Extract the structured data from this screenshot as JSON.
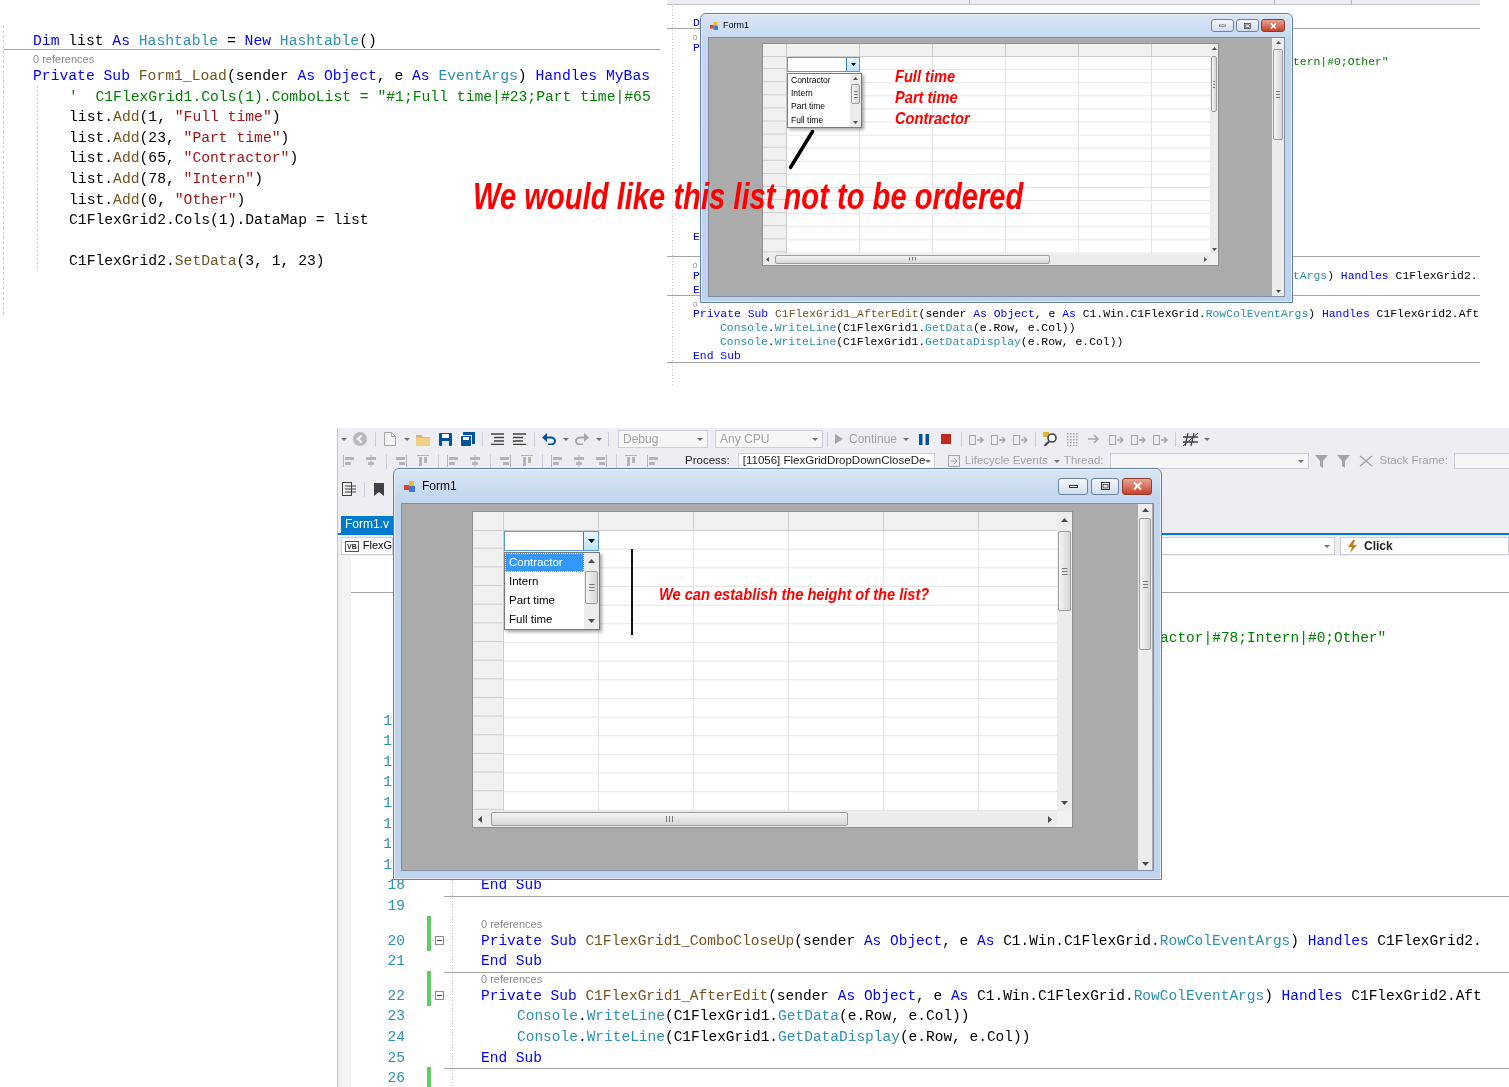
{
  "snippet": {
    "lines": [
      {
        "kind": "code",
        "separator_below": true,
        "tokens": [
          {
            "kind": "keyword",
            "text": "Dim "
          },
          {
            "kind": "plain",
            "text": "list "
          },
          {
            "kind": "keyword",
            "text": "As "
          },
          {
            "kind": "type",
            "text": "Hashtable"
          },
          {
            "kind": "plain",
            "text": " = "
          },
          {
            "kind": "keyword",
            "text": "New "
          },
          {
            "kind": "type",
            "text": "Hashtable"
          },
          {
            "kind": "plain",
            "text": "()"
          }
        ]
      },
      {
        "kind": "lens",
        "text": "0 references"
      },
      {
        "kind": "code",
        "separator_below": false,
        "tokens": [
          {
            "kind": "keyword",
            "text": "Private Sub "
          },
          {
            "kind": "method",
            "text": "Form1_Load"
          },
          {
            "kind": "plain",
            "text": "(sender "
          },
          {
            "kind": "keyword",
            "text": "As Object"
          },
          {
            "kind": "plain",
            "text": ", e "
          },
          {
            "kind": "keyword",
            "text": "As "
          },
          {
            "kind": "type",
            "text": "EventArgs"
          },
          {
            "kind": "plain",
            "text": ") "
          },
          {
            "kind": "keyword",
            "text": "Handles MyBas"
          }
        ],
        "children": [
          {
            "kind": "code",
            "separator_below": false,
            "tokens": [
              {
                "kind": "comment",
                "text": "'  C1FlexGrid1.Cols(1).ComboList = \"#1;Full time|#23;Part time|#65"
              }
            ]
          },
          {
            "kind": "code",
            "separator_below": false,
            "tokens": [
              {
                "kind": "plain",
                "text": "list."
              },
              {
                "kind": "method",
                "text": "Add"
              },
              {
                "kind": "plain",
                "text": "(1, "
              },
              {
                "kind": "string",
                "text": "\"Full time\""
              },
              {
                "kind": "plain",
                "text": ")"
              }
            ]
          },
          {
            "kind": "code",
            "separator_below": false,
            "tokens": [
              {
                "kind": "plain",
                "text": "list."
              },
              {
                "kind": "method",
                "text": "Add"
              },
              {
                "kind": "plain",
                "text": "(23, "
              },
              {
                "kind": "string",
                "text": "\"Part time\""
              },
              {
                "kind": "plain",
                "text": ")"
              }
            ]
          },
          {
            "kind": "code",
            "separator_below": false,
            "tokens": [
              {
                "kind": "plain",
                "text": "list."
              },
              {
                "kind": "method",
                "text": "Add"
              },
              {
                "kind": "plain",
                "text": "(65, "
              },
              {
                "kind": "string",
                "text": "\"Contractor\""
              },
              {
                "kind": "plain",
                "text": ")"
              }
            ]
          },
          {
            "kind": "code",
            "separator_below": false,
            "tokens": [
              {
                "kind": "plain",
                "text": "list."
              },
              {
                "kind": "method",
                "text": "Add"
              },
              {
                "kind": "plain",
                "text": "(78, "
              },
              {
                "kind": "string",
                "text": "\"Intern\""
              },
              {
                "kind": "plain",
                "text": ")"
              }
            ]
          },
          {
            "kind": "code",
            "separator_below": false,
            "tokens": [
              {
                "kind": "plain",
                "text": "list."
              },
              {
                "kind": "method",
                "text": "Add"
              },
              {
                "kind": "plain",
                "text": "(0, "
              },
              {
                "kind": "string",
                "text": "\"Other\""
              },
              {
                "kind": "plain",
                "text": ")"
              }
            ]
          },
          {
            "kind": "code",
            "separator_below": false,
            "tokens": [
              {
                "kind": "plain",
                "text": "C1FlexGrid2.Cols(1).DataMap = list"
              }
            ]
          },
          {
            "kind": "blank"
          },
          {
            "kind": "code",
            "separator_below": false,
            "tokens": [
              {
                "kind": "plain",
                "text": "C1FlexGrid2."
              },
              {
                "kind": "method",
                "text": "SetData"
              },
              {
                "kind": "plain",
                "text": "(3, 1, 23)"
              }
            ]
          }
        ]
      }
    ]
  },
  "annotation": {
    "text": "We would like this list not to be ordered"
  },
  "top_screenshot": {
    "upper_lines": [
      {
        "kind": "code",
        "separator_below": true,
        "left": [
          {
            "kind": "keyword",
            "text": "D"
          }
        ]
      },
      {
        "kind": "lens",
        "text": "0"
      },
      {
        "kind": "code",
        "separator_below": false,
        "left": [
          {
            "kind": "keyword",
            "text": "P"
          }
        ]
      },
      {
        "kind": "code",
        "separator_below": false,
        "right": [
          {
            "kind": "comment",
            "text": "tern|#0;Other\""
          }
        ]
      }
    ],
    "lower_lines": [
      {
        "kind": "code",
        "separator_below": false,
        "left": [
          {
            "kind": "keyword",
            "text": "E"
          }
        ]
      },
      {
        "kind": "blank",
        "separator_below": true
      },
      {
        "kind": "lens",
        "text": "0"
      },
      {
        "kind": "code",
        "separator_below": false,
        "left": [
          {
            "kind": "keyword",
            "text": "P"
          }
        ],
        "right": [
          {
            "kind": "type",
            "text": "tArgs"
          },
          {
            "kind": "plain",
            "text": ") "
          },
          {
            "kind": "keyword",
            "text": "Handles "
          },
          {
            "kind": "plain",
            "text": "C1FlexGrid2."
          }
        ]
      },
      {
        "kind": "code",
        "separator_below": true,
        "left": [
          {
            "kind": "keyword",
            "text": "E"
          }
        ]
      },
      {
        "kind": "lens",
        "text": "0"
      },
      {
        "kind": "code",
        "separator_below": false,
        "tokens": [
          {
            "kind": "keyword",
            "text": "Private Sub "
          },
          {
            "kind": "method",
            "text": "C1FlexGrid1_AfterEdit"
          },
          {
            "kind": "plain",
            "text": "(sender "
          },
          {
            "kind": "keyword",
            "text": "As Object"
          },
          {
            "kind": "plain",
            "text": ", e "
          },
          {
            "kind": "keyword",
            "text": "As "
          },
          {
            "kind": "plain",
            "text": "C1.Win.C1FlexGrid."
          },
          {
            "kind": "type",
            "text": "RowColEventArgs"
          },
          {
            "kind": "plain",
            "text": ") "
          },
          {
            "kind": "keyword",
            "text": "Handles "
          },
          {
            "kind": "plain",
            "text": "C1FlexGrid2.Aft"
          }
        ],
        "children": [
          {
            "kind": "code",
            "separator_below": false,
            "tokens": [
              {
                "kind": "type",
                "text": "Console"
              },
              {
                "kind": "plain",
                "text": "."
              },
              {
                "kind": "type",
                "text": "WriteLine"
              },
              {
                "kind": "plain",
                "text": "(C1FlexGrid1."
              },
              {
                "kind": "type",
                "text": "GetData"
              },
              {
                "kind": "plain",
                "text": "(e.Row, e.Col))"
              }
            ]
          },
          {
            "kind": "code",
            "separator_below": false,
            "tokens": [
              {
                "kind": "type",
                "text": "Console"
              },
              {
                "kind": "plain",
                "text": "."
              },
              {
                "kind": "type",
                "text": "WriteLine"
              },
              {
                "kind": "plain",
                "text": "(C1FlexGrid1."
              },
              {
                "kind": "type",
                "text": "GetDataDisplay"
              },
              {
                "kind": "plain",
                "text": "(e.Row, e.Col))"
              }
            ]
          }
        ]
      },
      {
        "kind": "code",
        "separator_below": true,
        "tokens": [
          {
            "kind": "keyword",
            "text": "End Sub"
          }
        ]
      }
    ],
    "form": {
      "title": "Form1",
      "list_items": [
        {
          "text": "Contractor",
          "selected": false
        },
        {
          "text": "Intern",
          "selected": false
        },
        {
          "text": "Part time",
          "selected": false
        },
        {
          "text": "Full time",
          "selected": false
        }
      ],
      "notes": [
        "Full time",
        "Part time",
        "Contractor"
      ]
    }
  },
  "bottom_screenshot": {
    "toolbar": {
      "configuration": {
        "text": "Debug",
        "disabled": true
      },
      "platform": {
        "text": "Any CPU",
        "disabled": true
      },
      "continue": {
        "text": "Continue",
        "disabled": true
      },
      "process_label": "Process:",
      "process": {
        "text": "[11056] FlexGridDropDownCloseDe",
        "disabled": false
      },
      "lifecycle_events": {
        "text": "Lifecycle Events",
        "disabled": true
      },
      "thread": {
        "label": "Thread:",
        "disabled": true
      },
      "stack_frame": {
        "label": "Stack Frame:",
        "disabled": true
      }
    },
    "document_tab": {
      "text": "Form1.v",
      "selected": true
    },
    "navigation": {
      "language": "VB",
      "type": "FlexG",
      "event": "Click"
    },
    "comment_tail": [
      {
        "kind": "comment",
        "text": "actor|#78;Intern|#0;Other\""
      }
    ],
    "gutter_fragments": [
      "1",
      "1",
      "1",
      "1",
      "1",
      "1",
      "1",
      "1"
    ],
    "lines": [
      {
        "kind": "code",
        "number": "18",
        "changed": false,
        "collapsible": false,
        "separator_below": true,
        "tokens": [
          {
            "kind": "keyword",
            "text": "End Sub"
          }
        ]
      },
      {
        "kind": "code",
        "number": "19",
        "changed": false,
        "collapsible": false,
        "separator_below": false
      },
      {
        "kind": "lens",
        "text": "0 references",
        "changed": true
      },
      {
        "kind": "code",
        "number": "20",
        "changed": true,
        "collapsible": true,
        "separator_below": false,
        "tokens": [
          {
            "kind": "keyword",
            "text": "Private Sub "
          },
          {
            "kind": "method",
            "text": "C1FlexGrid1_ComboCloseUp"
          },
          {
            "kind": "plain",
            "text": "(sender "
          },
          {
            "kind": "keyword",
            "text": "As Object"
          },
          {
            "kind": "plain",
            "text": ", e "
          },
          {
            "kind": "keyword",
            "text": "As "
          },
          {
            "kind": "plain",
            "text": "C1.Win.C1FlexGrid."
          },
          {
            "kind": "type",
            "text": "RowColEventArgs"
          },
          {
            "kind": "plain",
            "text": ") "
          },
          {
            "kind": "keyword",
            "text": "Handles "
          },
          {
            "kind": "plain",
            "text": "C1FlexGrid2."
          }
        ]
      },
      {
        "kind": "code",
        "number": "21",
        "changed": false,
        "collapsible": false,
        "separator_below": true,
        "tokens": [
          {
            "kind": "keyword",
            "text": "End Sub"
          }
        ]
      },
      {
        "kind": "lens",
        "text": "0 references",
        "changed": true
      },
      {
        "kind": "code",
        "number": "22",
        "changed": true,
        "collapsible": true,
        "separator_below": false,
        "tokens": [
          {
            "kind": "keyword",
            "text": "Private Sub "
          },
          {
            "kind": "method",
            "text": "C1FlexGrid1_AfterEdit"
          },
          {
            "kind": "plain",
            "text": "(sender "
          },
          {
            "kind": "keyword",
            "text": "As Object"
          },
          {
            "kind": "plain",
            "text": ", e "
          },
          {
            "kind": "keyword",
            "text": "As "
          },
          {
            "kind": "plain",
            "text": "C1.Win.C1FlexGrid."
          },
          {
            "kind": "type",
            "text": "RowColEventArgs"
          },
          {
            "kind": "plain",
            "text": ") "
          },
          {
            "kind": "keyword",
            "text": "Handles "
          },
          {
            "kind": "plain",
            "text": "C1FlexGrid2.Aft"
          }
        ],
        "children": [
          {
            "kind": "code",
            "number": "23",
            "changed": false,
            "collapsible": false,
            "separator_below": false,
            "tokens": [
              {
                "kind": "type",
                "text": "Console"
              },
              {
                "kind": "plain",
                "text": "."
              },
              {
                "kind": "type",
                "text": "WriteLine"
              },
              {
                "kind": "plain",
                "text": "(C1FlexGrid1."
              },
              {
                "kind": "type",
                "text": "GetData"
              },
              {
                "kind": "plain",
                "text": "(e.Row, e.Col))"
              }
            ]
          },
          {
            "kind": "code",
            "number": "24",
            "changed": false,
            "collapsible": false,
            "separator_below": false,
            "tokens": [
              {
                "kind": "type",
                "text": "Console"
              },
              {
                "kind": "plain",
                "text": "."
              },
              {
                "kind": "type",
                "text": "WriteLine"
              },
              {
                "kind": "plain",
                "text": "(C1FlexGrid1."
              },
              {
                "kind": "type",
                "text": "GetDataDisplay"
              },
              {
                "kind": "plain",
                "text": "(e.Row, e.Col))"
              }
            ]
          }
        ]
      },
      {
        "kind": "code",
        "number": "25",
        "changed": false,
        "collapsible": false,
        "separator_below": true,
        "tokens": [
          {
            "kind": "keyword",
            "text": "End Sub"
          }
        ]
      },
      {
        "kind": "code",
        "number": "26",
        "changed": true,
        "collapsible": false,
        "separator_below": false
      }
    ],
    "form": {
      "title": "Form1",
      "list_items": [
        {
          "text": "Contractor",
          "selected": true
        },
        {
          "text": "Intern",
          "selected": false
        },
        {
          "text": "Part time",
          "selected": false
        },
        {
          "text": "Full time",
          "selected": false
        }
      ],
      "note": "We can establish the height of the list?"
    }
  }
}
